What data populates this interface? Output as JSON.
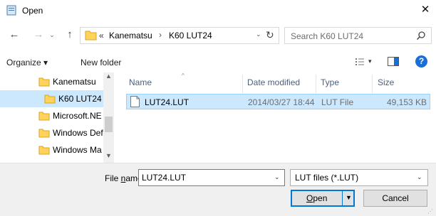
{
  "window": {
    "title": "Open",
    "close_glyph": "✕"
  },
  "navigation": {
    "back_glyph": "←",
    "forward_glyph": "→",
    "recent_glyph": "⌄",
    "up_glyph": "↑"
  },
  "address": {
    "overflow": "«",
    "crumbs": [
      "Kanematsu",
      "K60 LUT24"
    ],
    "separator": "›",
    "dropdown_glyph": "⌄",
    "refresh_glyph": "↻"
  },
  "search": {
    "placeholder": "Search K60 LUT24"
  },
  "toolbar": {
    "organize_label": "Organize ▾",
    "new_folder_label": "New folder",
    "views_drop_glyph": "▾",
    "help_label": "?"
  },
  "sidebar": {
    "items": [
      {
        "label": "Kanematsu",
        "selected": false
      },
      {
        "label": "K60 LUT24",
        "selected": true
      },
      {
        "label": "Microsoft.NE",
        "selected": false
      },
      {
        "label": "Windows Def",
        "selected": false
      },
      {
        "label": "Windows Ma",
        "selected": false
      }
    ],
    "scroll_up": "▲",
    "scroll_down": "▼"
  },
  "filelist": {
    "columns": [
      "Name",
      "Date modified",
      "Type",
      "Size"
    ],
    "sort_glyph": "^",
    "rows": [
      {
        "name": "LUT24.LUT",
        "date": "2014/03/27 18:44",
        "type": "LUT File",
        "size": "49,153 KB"
      }
    ]
  },
  "bottom": {
    "file_name_label_pre": "File ",
    "file_name_label_accel": "n",
    "file_name_label_post": "ame:",
    "file_name_value": "LUT24.LUT",
    "dropdown_glyph": "⌄",
    "file_type_value": "LUT files (*.LUT)",
    "open_accel": "O",
    "open_rest": "pen",
    "open_arrow": "▼",
    "cancel_label": "Cancel",
    "grip_glyph": "⋰"
  },
  "colors": {
    "selection": "#cce8ff",
    "selection_border": "#99d1ff",
    "accent": "#0078d7",
    "folder_yellow": "#ffd35c"
  }
}
